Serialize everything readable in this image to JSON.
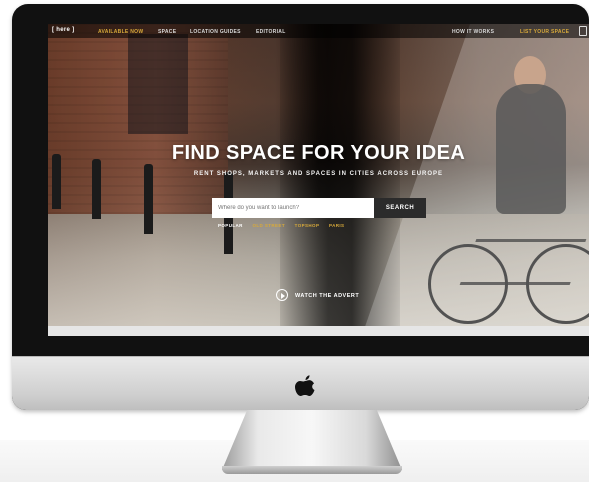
{
  "nav": {
    "brand": "[ here ]",
    "items": [
      "AVAILABLE NOW",
      "SPACE",
      "LOCATION GUIDES",
      "EDITORIAL"
    ],
    "right_items": [
      "HOW IT WORKS",
      "LIST YOUR SPACE"
    ]
  },
  "hero": {
    "title": "FIND SPACE FOR YOUR IDEA",
    "subtitle": "RENT SHOPS, MARKETS AND SPACES IN CITIES ACROSS EUROPE"
  },
  "search": {
    "placeholder": "Where do you want to launch?",
    "button_label": "SEARCH"
  },
  "popular": {
    "label": "POPULAR",
    "links": [
      "OLD STREET",
      "TOPSHOP",
      "PARIS"
    ]
  },
  "video": {
    "label": "WATCH THE ADVERT"
  },
  "colors": {
    "accent": "#d7a93a",
    "button": "#2b2b2b",
    "bezel": "#111111"
  }
}
